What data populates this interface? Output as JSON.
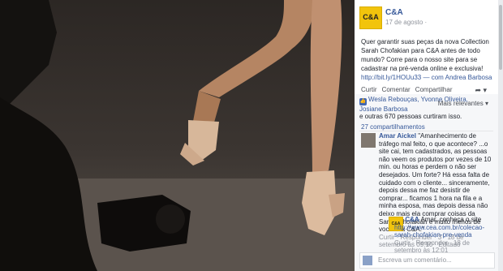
{
  "post": {
    "page_name": "C&A",
    "logo_text": "C&A",
    "date": "17 de agosto ·",
    "caption_text": "Quer garantir suas peças da nova Collection Sarah Chofakian para C&A antes de todo mundo? Corre para o nosso site para se cadastrar na pré-venda online e exclusiva! ",
    "caption_link": "http://bit.ly/1HOUu33",
    "caption_with": " — com Andrea Barbosa",
    "actions": [
      "Curtir",
      "Comentar",
      "Compartilhar"
    ],
    "share_icon": "share-arrow-icon"
  },
  "engagement": {
    "likers": "Wesla Rebouças, Yvonne Oliveira,",
    "likers2": "Josiane Barbosa",
    "others": "e outras 670 pessoas curtiram isso.",
    "more_relevant": "Mais relevantes ▾",
    "shares": "27 compartilhamentos"
  },
  "comments": [
    {
      "author": "Amar Aickel",
      "text": "\"Amanhecimento de tráfego mal feito, o que acontece? ...o site cai, tem cadastrados, as pessoas não veem os produtos por vezes de 10 min. ou horas e perdem o não ser desejados. Um forte? Há essa falta de cuidado com o cliente... sinceramente, depois dessa me faz desistir de comprar... ficamos 1 hora na fila e a minha esposa, mas depois dessa não deixo mais ela comprar coisas da Sarah Chofakian e muito menos de vocês da C&A.\"",
      "meta": "Curtir · Responder · 3 · 18 de setembro às 09:10 · Editado"
    },
    {
      "author": "C&A",
      "text": " Amar, conheça o site ",
      "link": "http://www.cea.com.br/colecao-sarah-chofakian-pre-venda",
      "meta": "Curtir · Responder · 18 de setembro às 12:01"
    }
  ],
  "reply": {
    "placeholder": "Escreva um comentário..."
  }
}
